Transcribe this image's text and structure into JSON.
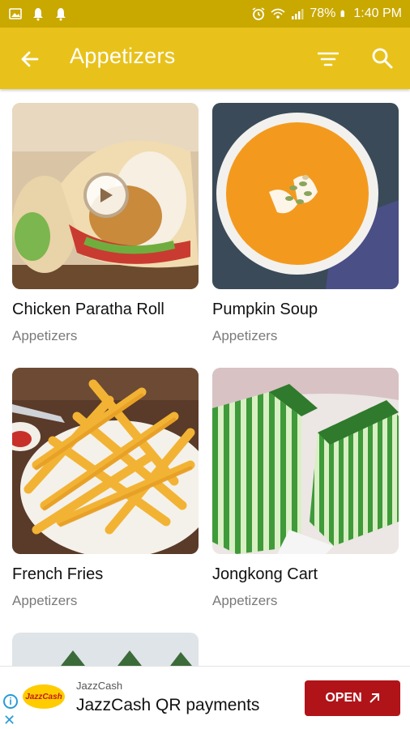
{
  "status_bar": {
    "battery": "78%",
    "time": "1:40 PM"
  },
  "app_bar": {
    "title": "Appetizers"
  },
  "recipes": [
    {
      "title": "Chicken Paratha Roll",
      "category": "Appetizers",
      "has_video": true
    },
    {
      "title": "Pumpkin Soup",
      "category": "Appetizers",
      "has_video": false
    },
    {
      "title": "French Fries",
      "category": "Appetizers",
      "has_video": false
    },
    {
      "title": "Jongkong Cart",
      "category": "Appetizers",
      "has_video": false
    }
  ],
  "ad": {
    "brand": "JazzCash",
    "logo_text": "JazzCash",
    "headline": "JazzCash QR payments",
    "cta": "OPEN"
  },
  "colors": {
    "status_bar": "#c9a800",
    "app_bar": "#e8c21b",
    "ad_button": "#b01419"
  }
}
